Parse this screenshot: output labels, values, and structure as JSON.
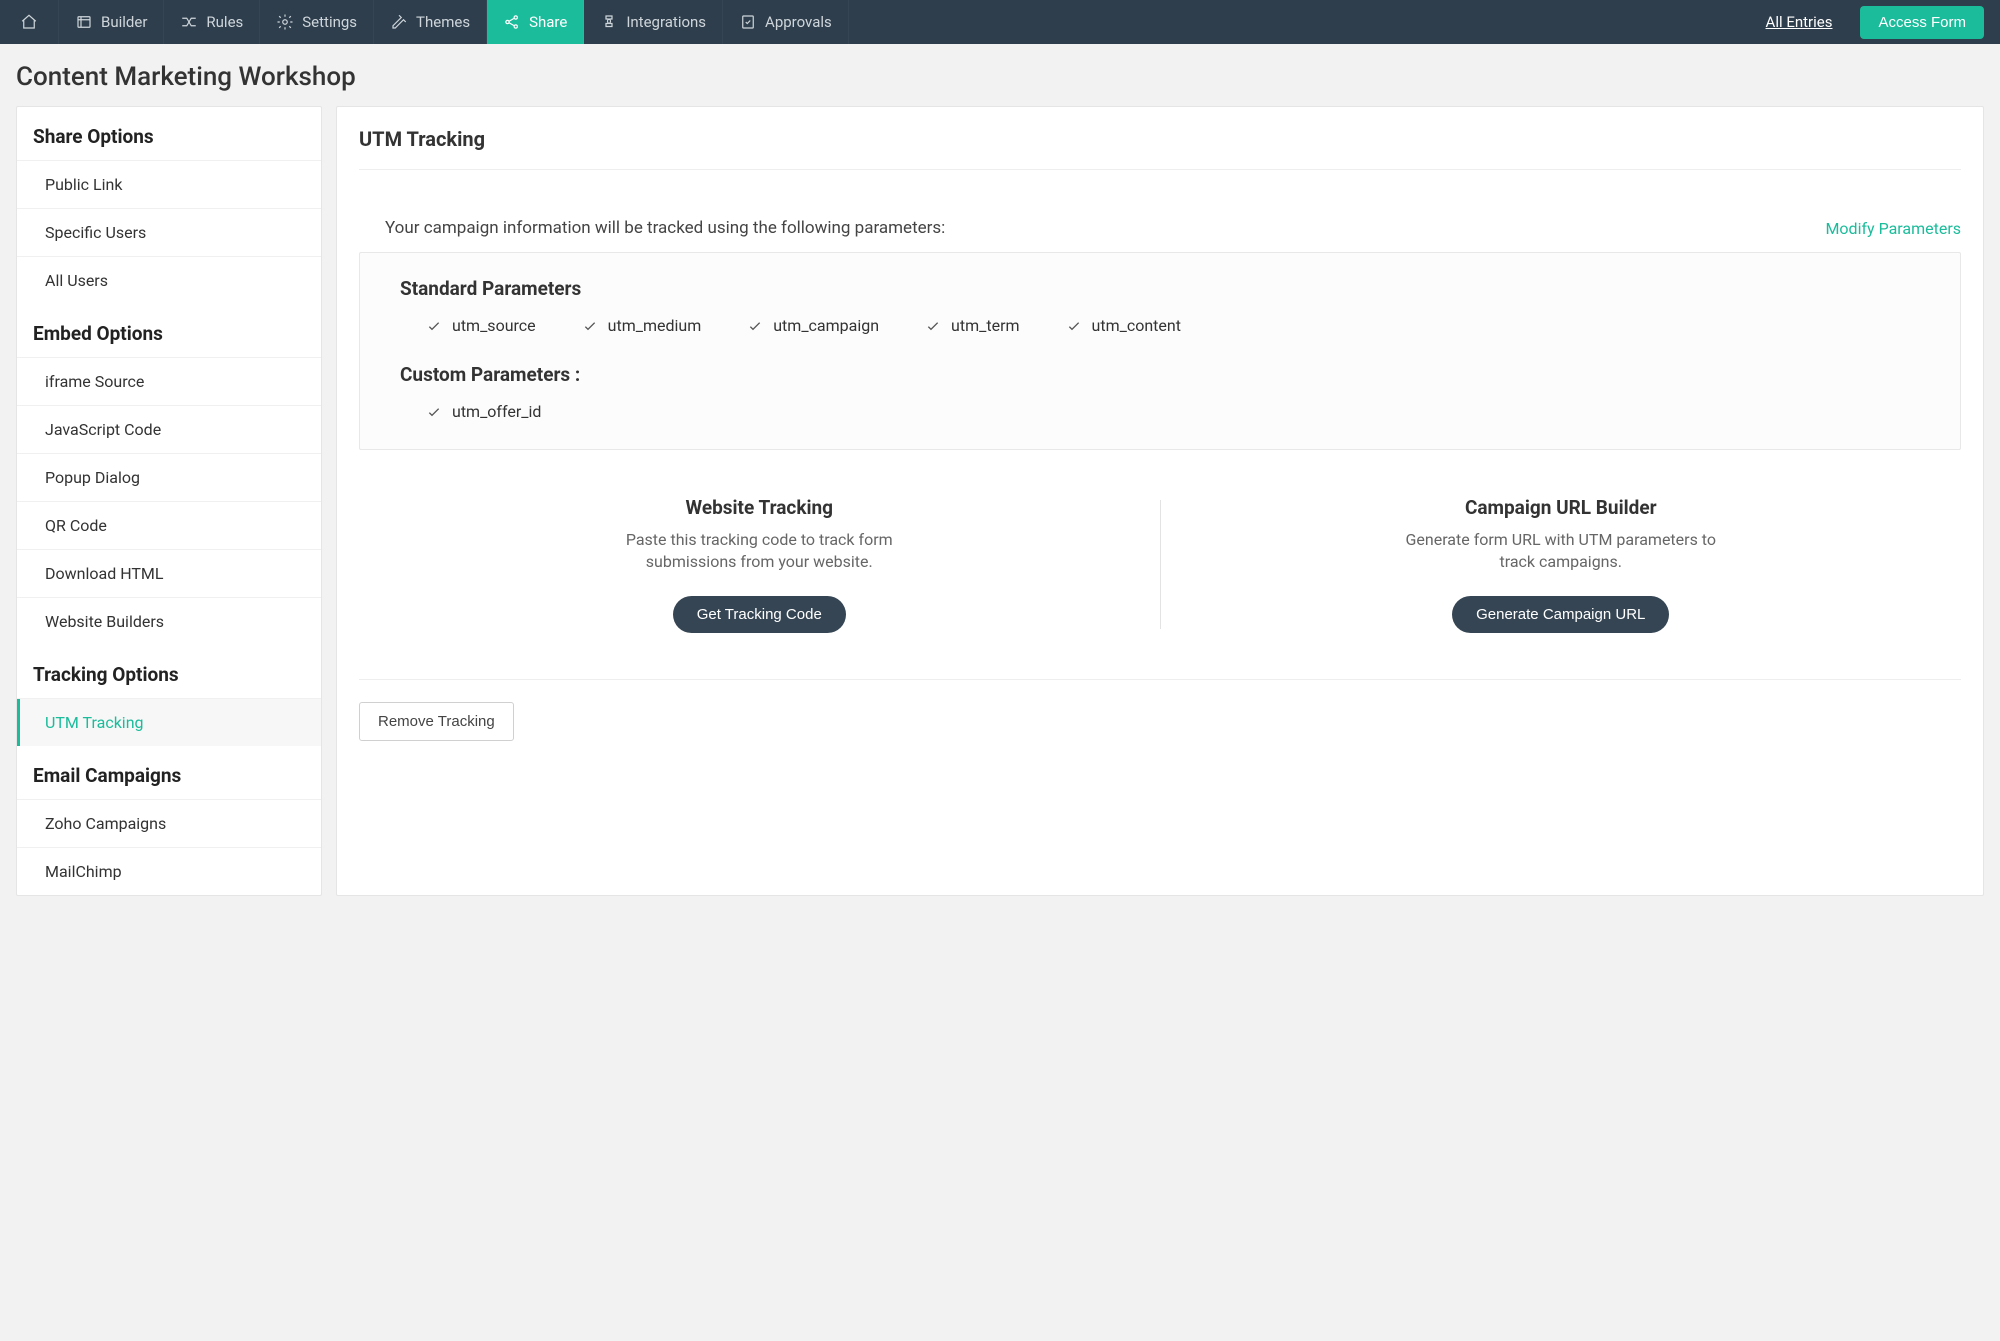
{
  "topnav": {
    "items": [
      {
        "label": "",
        "icon": "home"
      },
      {
        "label": "Builder",
        "icon": "builder"
      },
      {
        "label": "Rules",
        "icon": "rules"
      },
      {
        "label": "Settings",
        "icon": "settings"
      },
      {
        "label": "Themes",
        "icon": "themes"
      },
      {
        "label": "Share",
        "icon": "share",
        "active": true
      },
      {
        "label": "Integrations",
        "icon": "integrations"
      },
      {
        "label": "Approvals",
        "icon": "approvals"
      }
    ],
    "all_entries": "All Entries",
    "access_form": "Access Form"
  },
  "page_title": "Content Marketing Workshop",
  "sidebar": {
    "sections": [
      {
        "heading": "Share Options",
        "items": [
          {
            "label": "Public Link"
          },
          {
            "label": "Specific Users"
          },
          {
            "label": "All Users"
          }
        ]
      },
      {
        "heading": "Embed Options",
        "items": [
          {
            "label": "iframe Source"
          },
          {
            "label": "JavaScript Code"
          },
          {
            "label": "Popup Dialog"
          },
          {
            "label": "QR Code"
          },
          {
            "label": "Download HTML"
          },
          {
            "label": "Website Builders"
          }
        ]
      },
      {
        "heading": "Tracking Options",
        "items": [
          {
            "label": "UTM Tracking",
            "active": true
          }
        ]
      },
      {
        "heading": "Email Campaigns",
        "items": [
          {
            "label": "Zoho Campaigns"
          },
          {
            "label": "MailChimp"
          }
        ]
      }
    ]
  },
  "main": {
    "title": "UTM Tracking",
    "intro": "Your campaign information will be tracked using the following parameters:",
    "modify": "Modify Parameters",
    "standard_heading": "Standard Parameters",
    "standard_params": [
      "utm_source",
      "utm_medium",
      "utm_campaign",
      "utm_term",
      "utm_content"
    ],
    "custom_heading": "Custom Parameters :",
    "custom_params": [
      "utm_offer_id"
    ],
    "website": {
      "heading": "Website Tracking",
      "desc": "Paste this tracking code to track form submissions from your website.",
      "button": "Get Tracking Code"
    },
    "campaign": {
      "heading": "Campaign URL Builder",
      "desc": "Generate form URL with UTM parameters to track campaigns.",
      "button": "Generate Campaign URL"
    },
    "remove": "Remove Tracking"
  }
}
